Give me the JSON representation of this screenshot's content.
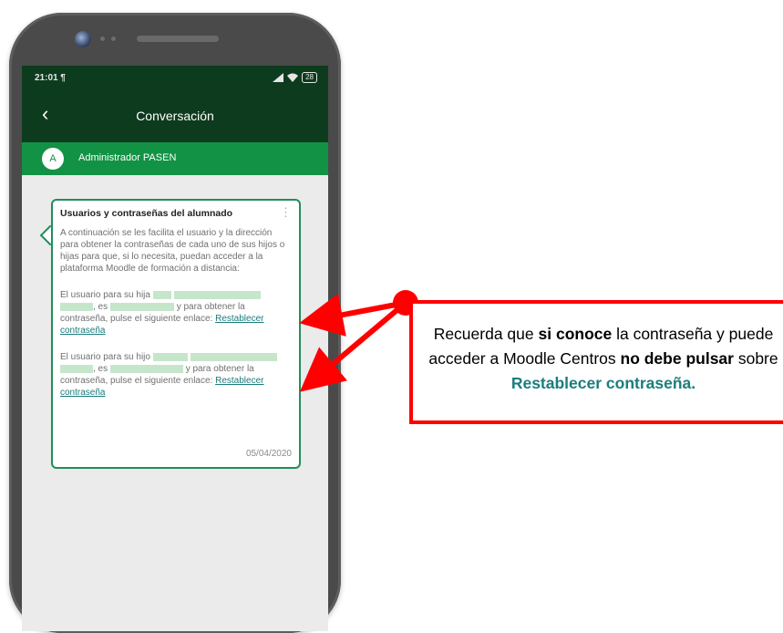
{
  "status": {
    "time": "21:01",
    "time_icon": "¶",
    "signal": "signal-icon",
    "wifi": "wifi-icon",
    "battery": "28"
  },
  "appbar": {
    "back_icon": "‹",
    "title": "Conversación"
  },
  "sender": {
    "initial": "A",
    "name": "Administrador PASEN"
  },
  "message": {
    "title": "Usuarios y contraseñas del alumnado",
    "intro": "A continuación se les facilita el usuario y la dirección para obtener la contraseñas de cada uno de sus hijos o hijas para que, si lo necesita, puedan acceder a la plataforma Moodle de formación a distancia:",
    "p1_a": "El usuario para su hija",
    "p2_a": "El usuario para su hijo",
    "es": ", es",
    "obtain": "y para obtener la",
    "contraseña_line": "contraseña, pulse el siguiente enlace:",
    "link": "Restablecer contraseña",
    "date": "05/04/2020",
    "menu_icon": "⋮"
  },
  "callout": {
    "t1": "Recuerda que ",
    "b1": "si conoce",
    "t2": " la contraseña y puede acceder a Moodle Centros ",
    "b2": "no debe pulsar",
    "t3": " sobre ",
    "b3": "Restablecer contraseña."
  },
  "colors": {
    "dark_green": "#0d3b1e",
    "green": "#129244",
    "teal_link": "#1b7c7a",
    "red": "#ff0000"
  }
}
